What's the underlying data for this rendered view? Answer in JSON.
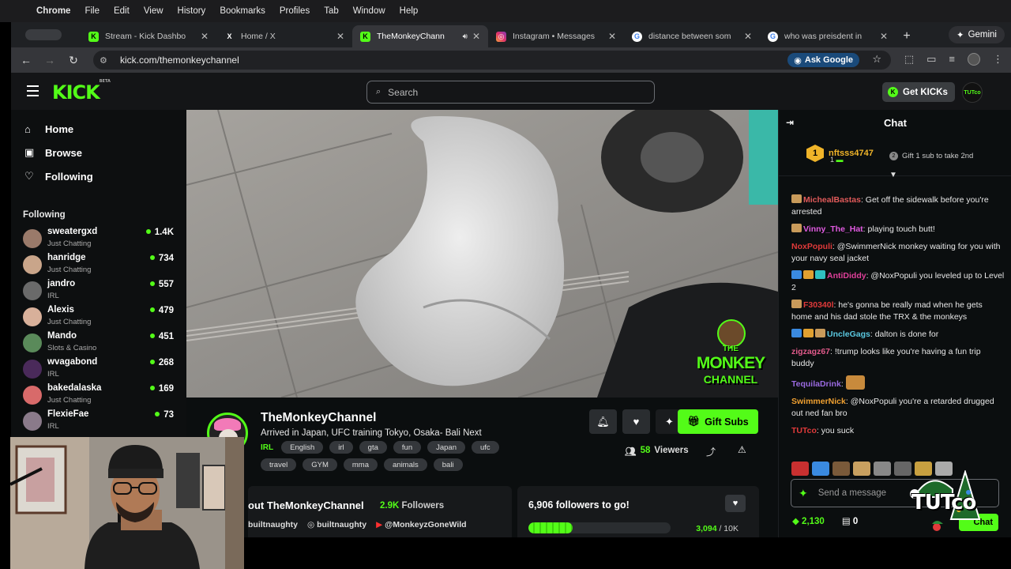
{
  "menubar": {
    "app": "Chrome",
    "items": [
      "File",
      "Edit",
      "View",
      "History",
      "Bookmarks",
      "Profiles",
      "Tab",
      "Window",
      "Help"
    ]
  },
  "tabs": [
    {
      "title": "Stream - Kick Dashbo",
      "fav": "K",
      "fav_color": "#53fc18"
    },
    {
      "title": "Home / X",
      "fav": "X",
      "fav_color": "#ffffff"
    },
    {
      "title": "TheMonkeyChann",
      "fav": "K",
      "fav_color": "#53fc18",
      "active": true
    },
    {
      "title": "Instagram • Messages",
      "fav": "◎",
      "fav_color": "#e1306c"
    },
    {
      "title": "distance between som",
      "fav": "G",
      "fav_color": "#4285f4"
    },
    {
      "title": "who was preisdent in",
      "fav": "G",
      "fav_color": "#4285f4"
    }
  ],
  "gemini_label": "Gemini",
  "url": "kick.com/themonkeychannel",
  "ask_google": "Ask Google",
  "kick": {
    "logo": "KICK",
    "logo_sup": "BETA",
    "search_placeholder": "Search",
    "get_kicks": "Get KICKs",
    "header_avatar": "TUTco"
  },
  "sidebar": {
    "nav": [
      {
        "label": "Home",
        "icon": "home-icon"
      },
      {
        "label": "Browse",
        "icon": "browse-icon"
      },
      {
        "label": "Following",
        "icon": "heart-icon"
      }
    ],
    "following_heading": "Following",
    "following": [
      {
        "name": "sweatergxd",
        "category": "Just Chatting",
        "viewers": "1.4K",
        "color": "#9a7a6a"
      },
      {
        "name": "hanridge",
        "category": "Just Chatting",
        "viewers": "734",
        "color": "#c9a58a"
      },
      {
        "name": "jandro",
        "category": "IRL",
        "viewers": "557",
        "color": "#6a6a6a"
      },
      {
        "name": "Alexis",
        "category": "Just Chatting",
        "viewers": "479",
        "color": "#d8b09a"
      },
      {
        "name": "Mando",
        "category": "Slots & Casino",
        "viewers": "451",
        "color": "#5a8a5a"
      },
      {
        "name": "wvagabond",
        "category": "IRL",
        "viewers": "268",
        "color": "#4a2a5a"
      },
      {
        "name": "bakedalaska",
        "category": "Just Chatting",
        "viewers": "169",
        "color": "#d86a6a"
      },
      {
        "name": "FlexieFae",
        "category": "IRL",
        "viewers": "73",
        "color": "#8a7a8a"
      }
    ]
  },
  "stream": {
    "channel": "TheMonkeyChannel",
    "title": "Arrived in Japan, UFC training Tokyo, Osaka- Bali Next",
    "category": "IRL",
    "tags": [
      "English",
      "irl",
      "gta",
      "fun",
      "Japan",
      "ufc",
      "travel",
      "GYM",
      "mma",
      "animals",
      "bali"
    ],
    "gift_subs": "Gift Subs",
    "viewers_count": "58",
    "viewers_label": "Viewers",
    "about_title": "out TheMonkeyChannel",
    "followers_count": "2.9K",
    "followers_label": "Followers",
    "socials": [
      "builtnaughty",
      "builtnaughty",
      "@MonkeyzGoneWild"
    ],
    "goal_title": "6,906 followers to go!",
    "goal_current": "3,094",
    "goal_target": "/ 10K",
    "goal_fraction": 0.31,
    "overlay_logo_line1": "THE",
    "overlay_logo_line2": "MONKEY",
    "overlay_logo_line3": "CHANNEL"
  },
  "chat": {
    "title": "Chat",
    "pinned_user": "nftsss4747",
    "pinned_rank": "1",
    "pinned_count": "1",
    "gift_prompt": "Gift 1 sub to take 2nd",
    "messages": [
      {
        "user": "MichealBastas",
        "color": "#e05a5a",
        "text": "Get off the sidewalk before you're arrested",
        "badges": [
          "#c89a5a"
        ]
      },
      {
        "user": "Vinny_The_Hat",
        "color": "#e05ae0",
        "text": "playing touch butt!",
        "badges": [
          "#c89a5a"
        ]
      },
      {
        "user": "NoxPopuli",
        "color": "#e03a3a",
        "text": "@SwimmerNick monkey waiting for you with your navy seal jacket",
        "badges": []
      },
      {
        "user": "AntiDiddy",
        "color": "#e0409a",
        "text": "@NoxPopuli you leveled up to Level 2",
        "badges": [
          "#3a8ae0",
          "#e0a030",
          "#30c0c0"
        ]
      },
      {
        "user": "F30340l",
        "color": "#e03a3a",
        "text": "he's gonna be really mad when he gets home and his dad stole the TRX & the monkeys",
        "badges": [
          "#c89a5a"
        ]
      },
      {
        "user": "UncleGags",
        "color": "#5ac8e0",
        "text": "dalton is done for",
        "badges": [
          "#3a8ae0",
          "#e0a030",
          "#c89a5a"
        ]
      },
      {
        "user": "zigzagz67",
        "color": "#e05a8a",
        "text": "!trump looks like you're having a fun trip buddy",
        "badges": []
      },
      {
        "user": "TequilaDrink",
        "color": "#9a6ae0",
        "text": "",
        "badges": [],
        "emote": true
      },
      {
        "user": "SwimmerNick",
        "color": "#f0a030",
        "text": "@NoxPopuli you're a retarded drugged out ned fan bro",
        "badges": []
      },
      {
        "user": "TUTco",
        "color": "#e03a3a",
        "text": "you suck",
        "badges": []
      }
    ],
    "input_placeholder": "Send a message",
    "points": "2,130",
    "gifts": "0",
    "chat_button": "Chat",
    "overlay_brand": "TUTco"
  }
}
